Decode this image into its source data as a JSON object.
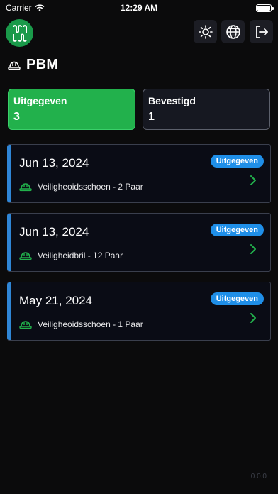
{
  "status_bar": {
    "carrier": "Carrier",
    "time": "12:29 AM"
  },
  "header": {
    "title": "PBM",
    "logo_icon": "ppe-logo-icon",
    "actions": [
      "sun-icon",
      "globe-icon",
      "logout-icon"
    ]
  },
  "stats": {
    "issued": {
      "label": "Uitgegeven",
      "value": "3"
    },
    "confirmed": {
      "label": "Bevestigd",
      "value": "1"
    }
  },
  "items": [
    {
      "date": "Jun 13, 2024",
      "status": "Uitgegeven",
      "description": "Veiligheoidsschoen - 2 Paar"
    },
    {
      "date": "Jun 13, 2024",
      "status": "Uitgegeven",
      "description": "Veiligheidbril - 12 Paar"
    },
    {
      "date": "May 21, 2024",
      "status": "Uitgegeven",
      "description": "Veiligheoidsschoen - 1 Paar"
    }
  ],
  "footer": {
    "version": "0.0.0"
  },
  "colors": {
    "accent_green": "#22b14c",
    "accent_blue": "#2f86d6",
    "badge_blue": "#1f8fe8",
    "background": "#0b0b0c"
  }
}
